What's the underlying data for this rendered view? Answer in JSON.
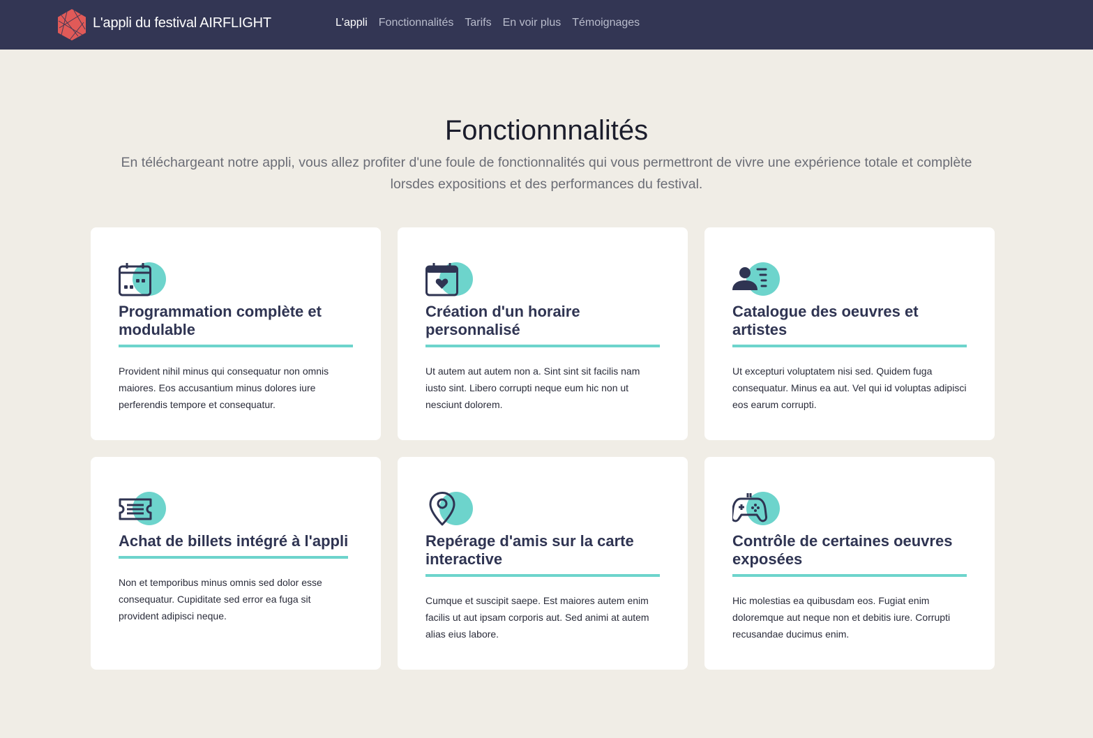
{
  "nav": {
    "brand": "L'appli du festival AIRFLIGHT",
    "links": [
      {
        "label": "L'appli",
        "active": true
      },
      {
        "label": "Fonctionnalités",
        "active": false
      },
      {
        "label": "Tarifs",
        "active": false
      },
      {
        "label": "En voir plus",
        "active": false
      },
      {
        "label": "Témoignages",
        "active": false
      }
    ]
  },
  "features": {
    "title": "Fonctionnnalités",
    "lead": "En téléchargeant notre appli, vous allez profiter d'une foule de fonctionnalités qui vous permettront de vivre une expérience totale et complète lorsdes expositions et des performances du festival.",
    "cards": [
      {
        "icon": "calendar-grid-icon",
        "title": "Programmation complète et modulable",
        "text": "Provident nihil minus qui consequatur non omnis maiores. Eos accusantium minus dolores iure perferendis tempore et consequatur."
      },
      {
        "icon": "calendar-heart-icon",
        "title": "Création d'un horaire personnalisé",
        "text": "Ut autem aut autem non a. Sint sint sit facilis nam iusto sint. Libero corrupti neque eum hic non ut nesciunt dolorem."
      },
      {
        "icon": "user-list-icon",
        "title": "Catalogue des oeuvres et artistes",
        "text": "Ut excepturi voluptatem nisi sed. Quidem fuga consequatur. Minus ea aut. Vel qui id voluptas adipisci eos earum corrupti."
      },
      {
        "icon": "ticket-icon",
        "title": "Achat de billets intégré à l'appli",
        "text": "Non et temporibus minus omnis sed dolor esse consequatur. Cupiditate sed error ea fuga sit provident adipisci neque."
      },
      {
        "icon": "map-pin-icon",
        "title": "Repérage d'amis sur la carte interactive",
        "text": "Cumque et suscipit saepe. Est maiores autem enim facilis ut aut ipsam corporis aut. Sed animi at autem alias eius labore."
      },
      {
        "icon": "gamepad-icon",
        "title": "Contrôle de certaines oeuvres exposées",
        "text": "Hic molestias ea quibusdam eos. Fugiat enim doloremque aut neque non et debitis iure. Corrupti recusandae ducimus enim."
      }
    ]
  },
  "colors": {
    "navbar": "#333654",
    "accent": "#6dd4cc",
    "logo": "#e15a58",
    "background": "#f0ede6"
  }
}
